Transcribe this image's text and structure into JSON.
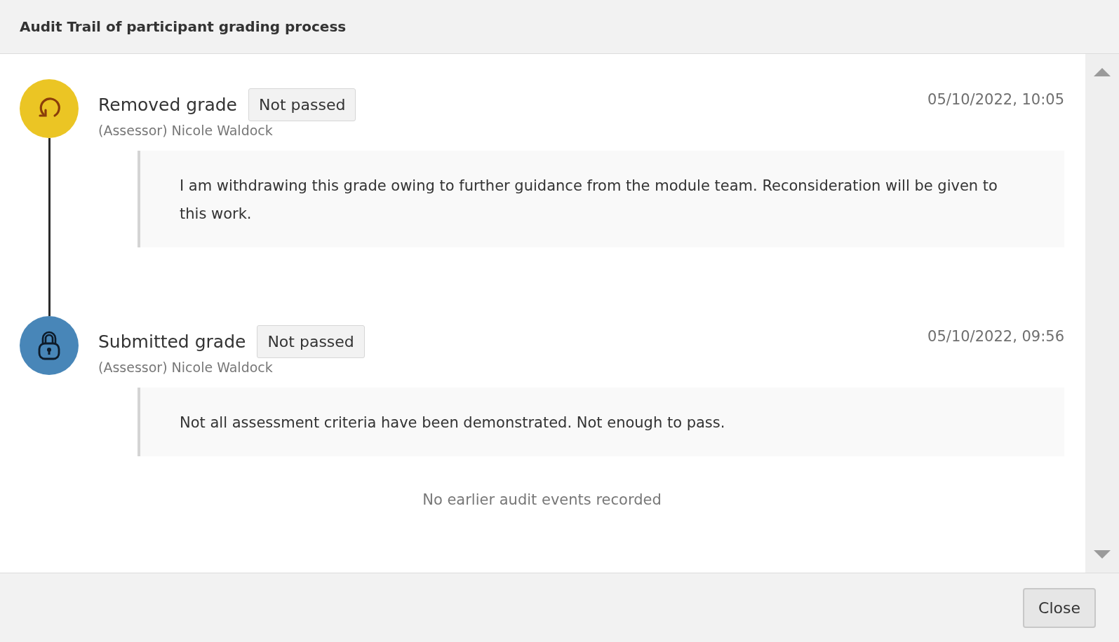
{
  "dialog": {
    "title": "Audit Trail of participant grading process"
  },
  "events": [
    {
      "kind": "removed",
      "title": "Removed grade",
      "grade": "Not passed",
      "actor": "(Assessor) Nicole Waldock",
      "time": "05/10/2022, 10:05",
      "comment": "I am withdrawing this grade owing to further guidance from the module team. Reconsideration will be given to this work."
    },
    {
      "kind": "submitted",
      "title": "Submitted grade",
      "grade": "Not passed",
      "actor": "(Assessor) Nicole Waldock",
      "time": "05/10/2022, 09:56",
      "comment": "Not all assessment criteria have been demonstrated. Not enough to pass."
    }
  ],
  "end_note": "No earlier audit events recorded",
  "buttons": [
    "Close"
  ]
}
